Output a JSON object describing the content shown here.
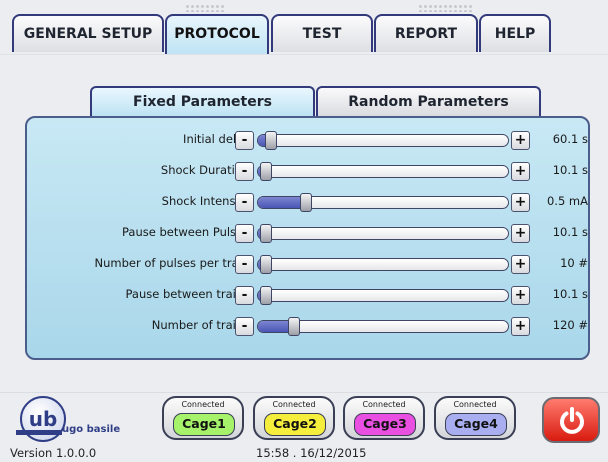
{
  "tabs": [
    {
      "label": "GENERAL SETUP",
      "active": false
    },
    {
      "label": "PROTOCOL",
      "active": true
    },
    {
      "label": "TEST",
      "active": false
    },
    {
      "label": "REPORT",
      "active": false
    },
    {
      "label": "HELP",
      "active": false
    }
  ],
  "subtabs": [
    {
      "label": "Fixed Parameters",
      "active": true
    },
    {
      "label": "Random Parameters",
      "active": false
    }
  ],
  "parameters": [
    {
      "label": "Initial delay:",
      "value": "60.1 s",
      "level": 0.02
    },
    {
      "label": "Shock Duration:",
      "value": "10.1 s",
      "level": 0.0
    },
    {
      "label": "Shock Intensity:",
      "value": "0.5 mA",
      "level": 0.17
    },
    {
      "label": "Pause between Pulses:",
      "value": "10.1 s",
      "level": 0.0
    },
    {
      "label": "Number of pulses per train:",
      "value": "10 #",
      "level": 0.0
    },
    {
      "label": "Pause between trains:",
      "value": "10.1 s",
      "level": 0.0
    },
    {
      "label": "Number of trains:",
      "value": "120 #",
      "level": 0.12
    }
  ],
  "slider_controls": {
    "minus": "-",
    "plus": "+"
  },
  "footer": {
    "logo_text": "ugo basile",
    "version": "Version 1.0.0.0",
    "datetime": "15:58 . 16/12/2015",
    "power_icon": "power-icon"
  },
  "cages": [
    {
      "status": "Connected",
      "label": "Cage1",
      "color": "#a6f26a"
    },
    {
      "status": "Connected",
      "label": "Cage2",
      "color": "#f6ee3c"
    },
    {
      "status": "Connected",
      "label": "Cage3",
      "color": "#e94fe0"
    },
    {
      "status": "Connected",
      "label": "Cage4",
      "color": "#a9aef0"
    }
  ],
  "colors": {
    "accent_border": "#323a7c",
    "panel_bg": "#b8dfef",
    "slider_fill": "#4a56b6",
    "power_button": "#e0261b"
  }
}
